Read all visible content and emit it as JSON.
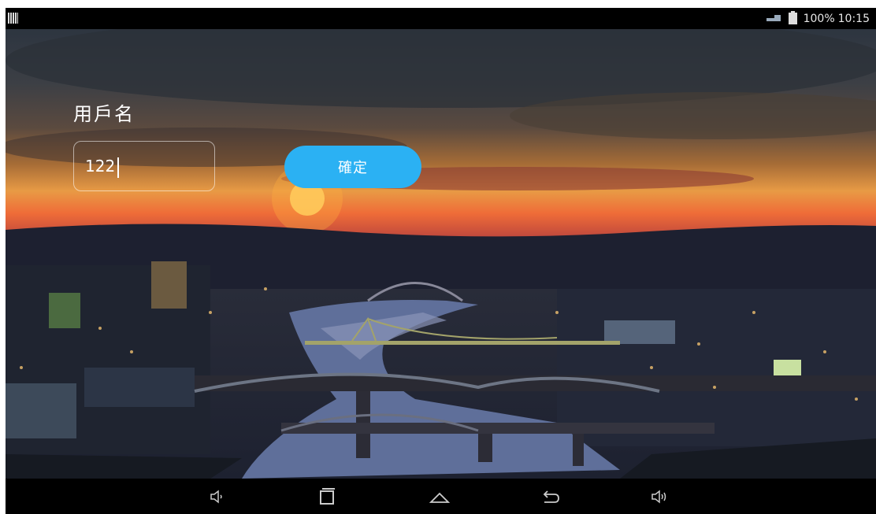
{
  "status_bar": {
    "battery": "100%",
    "time": "10:15",
    "icons": [
      "notification-icon",
      "network-icon",
      "battery-charging-icon"
    ]
  },
  "form": {
    "username_label": "用戶名",
    "username_value": "122",
    "confirm_label": "確定"
  },
  "nav_bar": {
    "icons": [
      "volume-down-icon",
      "recent-apps-icon",
      "home-icon",
      "back-icon",
      "volume-up-icon"
    ]
  },
  "colors": {
    "accent": "#2bb1f3",
    "system_bar": "#000000"
  }
}
